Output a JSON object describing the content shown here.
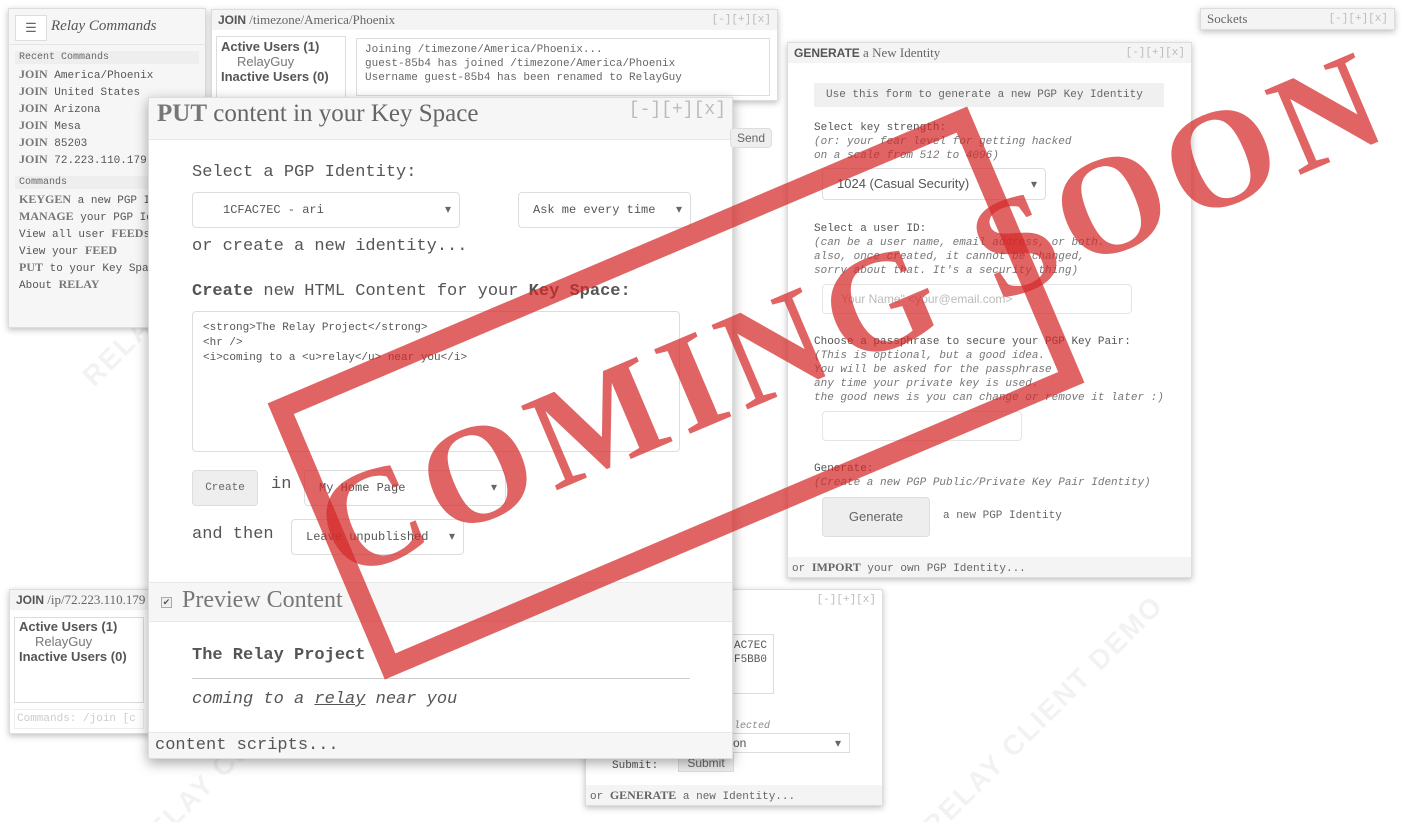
{
  "menu": {
    "title": "Relay Commands",
    "recent_heading": "Recent Commands",
    "recent": [
      {
        "cmd": "JOIN",
        "arg": "America/Phoenix"
      },
      {
        "cmd": "JOIN",
        "arg": "United States"
      },
      {
        "cmd": "JOIN",
        "arg": "Arizona"
      },
      {
        "cmd": "JOIN",
        "arg": "Mesa"
      },
      {
        "cmd": "JOIN",
        "arg": "85203"
      },
      {
        "cmd": "JOIN",
        "arg": "72.223.110.179"
      }
    ],
    "commands_heading": "Commands",
    "commands": [
      {
        "cmd": "KEYGEN",
        "arg": "a new PGP Ide"
      },
      {
        "cmd": "MANAGE",
        "arg": "your PGP Ide"
      },
      {
        "pre": "View all user",
        "cmd": "FEED",
        "arg": "s"
      },
      {
        "pre": "View your",
        "cmd": "FEED",
        "arg": ""
      },
      {
        "cmd": "PUT",
        "arg": "to your Key Spac"
      },
      {
        "pre": "About",
        "cmd": "RELAY",
        "arg": ""
      }
    ]
  },
  "join_tz": {
    "cmd": "JOIN",
    "path": "/timezone/America/Phoenix",
    "controls": "[-][+][x]",
    "active_label": "Active Users (1)",
    "user": "RelayGuy",
    "inactive_label": "Inactive Users (0)",
    "log": [
      "Joining /timezone/America/Phoenix...",
      "guest-85b4 has joined /timezone/America/Phoenix",
      "Username guest-85b4 has been renamed to RelayGuy"
    ],
    "send": "Send"
  },
  "sockets": {
    "title": "Sockets",
    "controls": "[-][+][x]"
  },
  "generate": {
    "cmd": "GENERATE",
    "title": "a New Identity",
    "controls": "[-][+][x]",
    "intro": "Use this form to generate a new PGP Key Identity",
    "strength_label": "Select key strength:",
    "strength_hint1": "(or: your fear level for getting hacked",
    "strength_hint2": "on a scale from 512 to 4096)",
    "strength_value": "1024 (Casual Security)",
    "uid_label": "Select a user ID:",
    "uid_hint1": "(can be a user name, email address, or both.",
    "uid_hint2": "also, once created, it cannot be changed,",
    "uid_hint3": "sorry about that. It's a security thing)",
    "uid_placeholder": "Your Name\" <your@email.com>",
    "pass_label": "Choose a passphrase to secure your PGP Key Pair:",
    "pass_hint1": "(This is optional, but a good idea.",
    "pass_hint2": "You will be asked for the passphrase",
    "pass_hint3": "any time your private key is used.",
    "pass_hint4": "the good news is you can change or remove it later :)",
    "gen_label": "Generate:",
    "gen_hint": "(Create a new PGP Public/Private Key Pair Identity)",
    "gen_button": "Generate",
    "gen_after": "a new PGP Identity",
    "footer_pre": "or",
    "footer_cmd": "IMPORT",
    "footer_post": "your own PGP Identity..."
  },
  "put": {
    "cmd": "PUT",
    "title": "content in your Key Space",
    "controls": "[-][+][x]",
    "identity_label": "Select a PGP Identity:",
    "identity_value": "1CFAC7EC - ari",
    "ask_value": "Ask me every time",
    "or_create": "or create a new identity...",
    "create_label_pre": "Create",
    "create_label_mid": "new HTML Content for your",
    "create_label_key": "Key Space:",
    "code_lines": [
      "<strong>The Relay Project</strong>",
      "<hr />",
      "<i>coming to a <u>relay</u> near you</i>"
    ],
    "create_button": "Create",
    "in_label": "in",
    "dest_value": "My Home Page",
    "and_then": "and then",
    "then_value": "Leave unpublished",
    "preview_label": "Preview Content",
    "preview_title": "The Relay Project",
    "preview_pre": "coming to a",
    "preview_link": "relay",
    "preview_post": "near you",
    "scripts_label": "content scripts..."
  },
  "join_ip": {
    "cmd": "JOIN",
    "path": "/ip/72.223.110.179",
    "active_label": "Active Users (1)",
    "user": "RelayGuy",
    "inactive_label": "Inactive Users (0)",
    "commands_placeholder": "Commands: /join [c"
  },
  "bottom": {
    "controls": "[-][+][x]",
    "key1": "AC7EC",
    "key2": "F5BB0",
    "selected_hint": "lected",
    "select_value": "on",
    "submit_label": "Submit:",
    "submit_button": "Submit",
    "footer_pre": "or",
    "footer_cmd": "GENERATE",
    "footer_post": "a new Identity..."
  },
  "stamp_text": "COMING SOON",
  "watermark": "RELAY CLIENT DEMO",
  "colors": {
    "stamp": "#d42828",
    "panel": "#f4f4f4",
    "border": "#dddddd"
  }
}
